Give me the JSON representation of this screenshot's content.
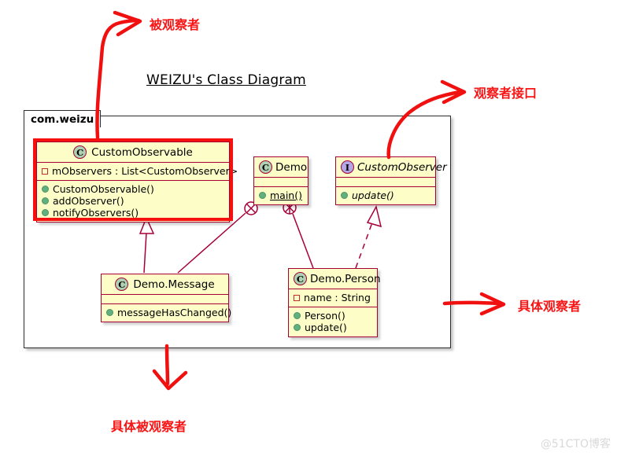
{
  "diagram": {
    "title": "WEIZU's Class Diagram",
    "package_name": "com.weizu"
  },
  "classes": {
    "custom_observable": {
      "name": "CustomObservable",
      "stereotype_badge": "C",
      "badge_kind": "class-badge",
      "fields": [
        {
          "visibility_icon": "private-field-icon",
          "text": "mObservers : List<CustomObserver>"
        }
      ],
      "methods": [
        {
          "visibility_icon": "public-method-icon",
          "text": "CustomObservable()"
        },
        {
          "visibility_icon": "public-method-icon",
          "text": "addObserver()"
        },
        {
          "visibility_icon": "public-method-icon",
          "text": "notifyObservers()"
        }
      ]
    },
    "demo": {
      "name": "Demo",
      "stereotype_badge": "C",
      "badge_kind": "class-badge",
      "fields": [],
      "methods": [
        {
          "visibility_icon": "public-method-icon",
          "text": "main()"
        }
      ]
    },
    "custom_observer": {
      "name": "CustomObserver",
      "stereotype_badge": "I",
      "badge_kind": "interface-badge",
      "fields": [],
      "methods": [
        {
          "visibility_icon": "public-method-icon",
          "text": "update()"
        }
      ]
    },
    "demo_message": {
      "name": "Demo.Message",
      "stereotype_badge": "C",
      "badge_kind": "class-badge",
      "fields": [],
      "methods": [
        {
          "visibility_icon": "public-method-icon",
          "text": "messageHasChanged()"
        }
      ]
    },
    "demo_person": {
      "name": "Demo.Person",
      "stereotype_badge": "C",
      "badge_kind": "class-badge",
      "fields": [
        {
          "visibility_icon": "private-field-icon",
          "text": "name : String"
        }
      ],
      "methods": [
        {
          "visibility_icon": "public-method-icon",
          "text": "Person()"
        },
        {
          "visibility_icon": "public-method-icon",
          "text": "update()"
        }
      ]
    }
  },
  "annotations": [
    {
      "id": "observable",
      "label": "被观察者"
    },
    {
      "id": "observer-interface",
      "label": "观察者接口"
    },
    {
      "id": "concrete-observer",
      "label": "具体观察者"
    },
    {
      "id": "concrete-observable",
      "label": "具体被观察者"
    }
  ],
  "watermark": {
    "text": "@51CTO博客"
  },
  "colors": {
    "class_fill": "#fdfdc8",
    "class_border": "#a80036",
    "class_badge_fill": "#add1b2",
    "interface_badge_fill": "#b4a7e5",
    "annotation_red": "#f71515",
    "highlight_red": "#f50f0f",
    "package_border": "#2b2b2b",
    "watermark_gray": "#d9d9d9"
  }
}
